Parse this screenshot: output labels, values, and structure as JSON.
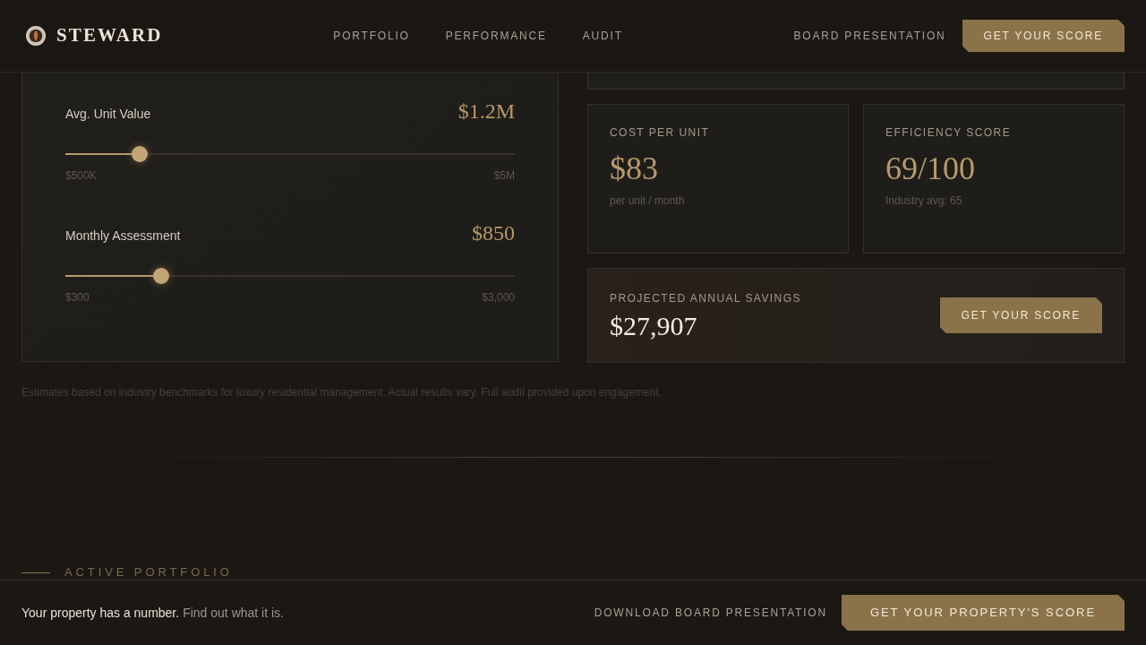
{
  "header": {
    "brand": "STEWARD",
    "nav": [
      {
        "label": "PORTFOLIO"
      },
      {
        "label": "PERFORMANCE"
      },
      {
        "label": "AUDIT"
      }
    ],
    "secondary_link": "BOARD PRESENTATION",
    "cta": "GET YOUR SCORE"
  },
  "calculator": {
    "sliders": [
      {
        "label": "Avg. Unit Value",
        "value": "$1.2M",
        "level": 0.165,
        "min": "$500K",
        "max": "$5M"
      },
      {
        "label": "Monthly Assessment",
        "value": "$850",
        "level": 0.214,
        "min": "$300",
        "max": "$3,000"
      }
    ]
  },
  "metrics": [
    {
      "label": "COST PER UNIT",
      "value": "$83",
      "note": "per unit / month"
    },
    {
      "label": "EFFICIENCY SCORE",
      "value": "69/100",
      "note": "Industry avg: 65"
    }
  ],
  "savings": {
    "label": "PROJECTED ANNUAL SAVINGS",
    "value": "$27,907",
    "button": "GET YOUR SCORE"
  },
  "disclaimer": "Estimates based on industry benchmarks for luxury residential management. Actual results vary. Full audit provided upon engagement.",
  "section_heading": "ACTIVE PORTFOLIO",
  "footer_bar": {
    "tagline": "Your property has a number.",
    "subtext": "Find out what it is.",
    "link": "DOWNLOAD BOARD PRESENTATION",
    "button": "GET YOUR PROPERTY'S SCORE"
  }
}
